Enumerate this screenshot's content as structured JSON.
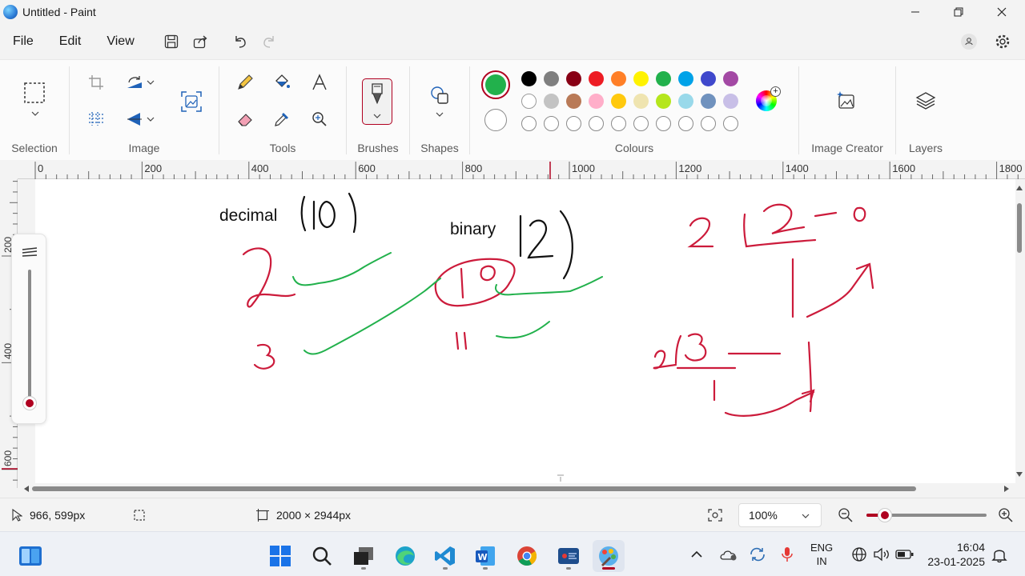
{
  "window": {
    "title": "Untitled - Paint"
  },
  "menu": {
    "file": "File",
    "edit": "Edit",
    "view": "View"
  },
  "ribbon": {
    "groups": {
      "selection": "Selection",
      "image": "Image",
      "tools": "Tools",
      "brushes": "Brushes",
      "shapes": "Shapes",
      "colours": "Colours",
      "image_creator": "Image Creator",
      "layers": "Layers"
    },
    "primary_color": "#22b14c",
    "secondary_color": "#ffffff",
    "palette": [
      "#000000",
      "#7f7f7f",
      "#880015",
      "#ed1c24",
      "#ff7f27",
      "#fff200",
      "#22b14c",
      "#00a2e8",
      "#3f48cc",
      "#a349a4",
      "#ffffff",
      "#c3c3c3",
      "#b97a57",
      "#ffaec9",
      "#ffc90e",
      "#efe4b0",
      "#b5e61d",
      "#99d9ea",
      "#7092be",
      "#c8bfe7"
    ]
  },
  "ruler": {
    "h_labels": [
      "0",
      "200",
      "400",
      "600",
      "800",
      "1000",
      "1200",
      "1400",
      "1600",
      "1800"
    ],
    "v_labels": [
      "200",
      "400",
      "600"
    ]
  },
  "canvas": {
    "text_decimal": "decimal",
    "text_binary": "binary"
  },
  "status": {
    "cursor_pos": "966, 599px",
    "canvas_size": "2000 × 2944px",
    "zoom": "100%"
  },
  "tray": {
    "lang_top": "ENG",
    "lang_bottom": "IN",
    "time": "16:04",
    "date": "23-01-2025"
  }
}
